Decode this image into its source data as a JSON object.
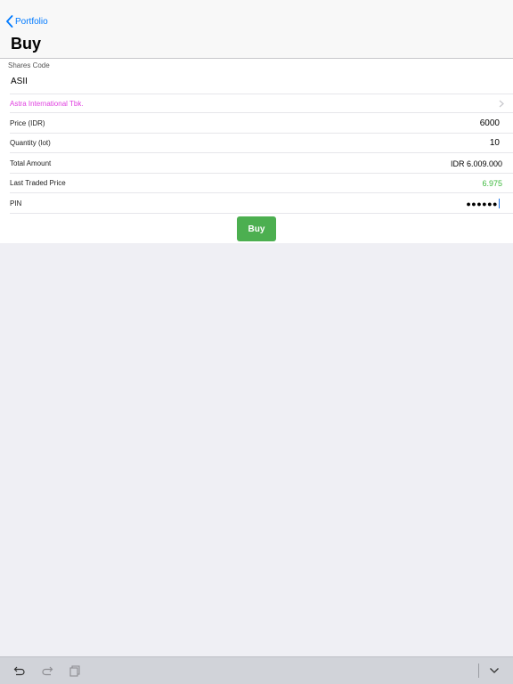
{
  "nav": {
    "back_label": "Portfolio",
    "title": "Buy"
  },
  "form": {
    "shares_code_label": "Shares Code",
    "shares_code_value": "ASII",
    "company_name": "Astra International Tbk.",
    "price_label": "Price (IDR)",
    "price_value": "6000",
    "quantity_label": "Quantity (lot)",
    "quantity_value": "10",
    "total_label": "Total Amount",
    "total_value": "IDR 6.009.000",
    "last_price_label": "Last Traded Price",
    "last_price_value": "6.975",
    "pin_label": "PIN",
    "pin_mask": "●●●●●●"
  },
  "actions": {
    "buy_label": "Buy"
  },
  "keyboard_bar": {
    "icons": [
      "undo-icon",
      "redo-icon",
      "paste-icon",
      "dismiss-keyboard-icon"
    ]
  },
  "colors": {
    "accent": "#007aff",
    "buy_button": "#4caf50",
    "last_price": "#3cb83c",
    "company_link": "#e040e0"
  }
}
